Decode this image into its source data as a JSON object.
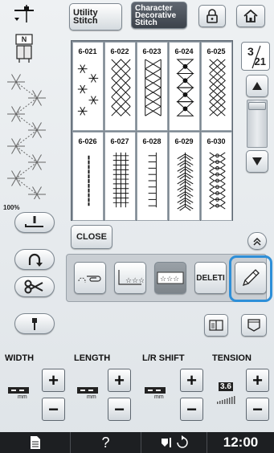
{
  "top_bar": {
    "utility_tab": "Utility Stitch",
    "utility_line1": "Utility",
    "utility_line2": "Stitch",
    "character_tab": "Character Decorative Stitch",
    "character_line1": "Character",
    "character_line2": "Decorative",
    "character_line3": "Stitch",
    "lock_icon": "lock-icon",
    "home_icon": "home-icon"
  },
  "left_panel": {
    "needle_icon": "single-needle-icon",
    "presser_foot_icon": "presser-foot-N-icon",
    "presser_foot_letter": "N",
    "zoom": "100%"
  },
  "stitch_grid": {
    "stitches": [
      {
        "code": "6-021",
        "pattern": "stars"
      },
      {
        "code": "6-022",
        "pattern": "diamond-lattice"
      },
      {
        "code": "6-023",
        "pattern": "cross-lattice"
      },
      {
        "code": "6-024",
        "pattern": "bow-chain"
      },
      {
        "code": "6-025",
        "pattern": "zigzag-diamonds"
      },
      {
        "code": "6-026",
        "pattern": "straight-dash"
      },
      {
        "code": "6-027",
        "pattern": "triple-ladder"
      },
      {
        "code": "6-028",
        "pattern": "side-ladder"
      },
      {
        "code": "6-029",
        "pattern": "feather"
      },
      {
        "code": "6-030",
        "pattern": "chain-hearts"
      }
    ]
  },
  "page_indicator": {
    "current": "3",
    "total": "21"
  },
  "buttons": {
    "close": "CLOSE",
    "delete": "DELETE",
    "delete_visible": "DELETI"
  },
  "params": {
    "width_label": "WIDTH",
    "length_label": "LENGTH",
    "lr_shift_label": "L/R SHIFT",
    "tension_label": "TENSION",
    "tension_value": "3.6",
    "unit": "mm",
    "plus": "+",
    "minus": "−"
  },
  "status_bar": {
    "time": "12:00",
    "help": "?",
    "accent": "#2e8fd8"
  },
  "colors": {
    "highlight_ring": "#2e8fd8",
    "statusbar_bg": "#1d1f22"
  }
}
